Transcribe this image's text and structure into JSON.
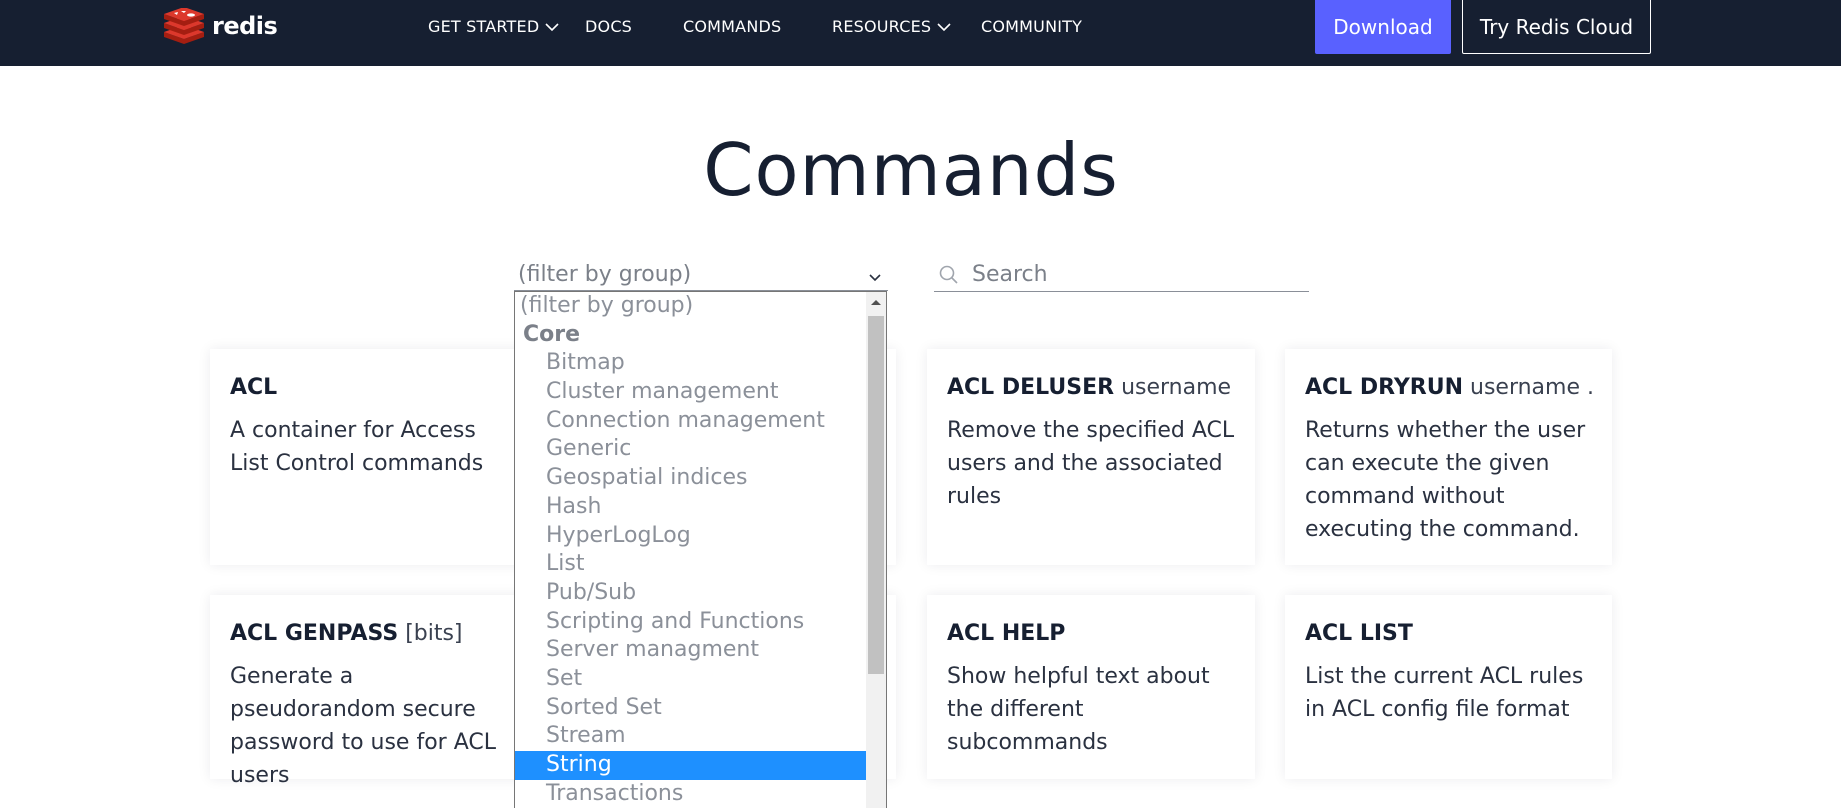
{
  "nav": {
    "logo_text": "redis",
    "items": [
      {
        "label": "GET STARTED",
        "has_dropdown": true
      },
      {
        "label": "DOCS",
        "has_dropdown": false
      },
      {
        "label": "COMMANDS",
        "has_dropdown": false
      },
      {
        "label": "RESOURCES",
        "has_dropdown": true
      },
      {
        "label": "COMMUNITY",
        "has_dropdown": false
      }
    ],
    "download_label": "Download",
    "cloud_label": "Try Redis Cloud"
  },
  "page": {
    "title": "Commands"
  },
  "filter": {
    "selected": "(filter by group)",
    "search_placeholder": "Search",
    "search_value": ""
  },
  "dropdown": {
    "options": [
      {
        "label": "(filter by group)",
        "kind": "placeholder"
      },
      {
        "label": "Core",
        "kind": "group"
      },
      {
        "label": "Bitmap",
        "kind": "item"
      },
      {
        "label": "Cluster management",
        "kind": "item"
      },
      {
        "label": "Connection management",
        "kind": "item"
      },
      {
        "label": "Generic",
        "kind": "item"
      },
      {
        "label": "Geospatial indices",
        "kind": "item"
      },
      {
        "label": "Hash",
        "kind": "item"
      },
      {
        "label": "HyperLogLog",
        "kind": "item"
      },
      {
        "label": "List",
        "kind": "item"
      },
      {
        "label": "Pub/Sub",
        "kind": "item"
      },
      {
        "label": "Scripting and Functions",
        "kind": "item"
      },
      {
        "label": "Server managment",
        "kind": "item"
      },
      {
        "label": "Set",
        "kind": "item"
      },
      {
        "label": "Sorted Set",
        "kind": "item"
      },
      {
        "label": "Stream",
        "kind": "item"
      },
      {
        "label": "String",
        "kind": "item",
        "highlighted": true
      },
      {
        "label": "Transactions",
        "kind": "item"
      }
    ]
  },
  "cards": [
    {
      "command": "ACL",
      "args": "",
      "description": "A container for Access List Control commands"
    },
    {
      "command": "ACL DELUSER",
      "args": "username ...",
      "description": "Remove the specified ACL users and the associated rules"
    },
    {
      "command": "ACL DRYRUN",
      "args": "username ...",
      "description": "Returns whether the user can execute the given command without executing the command."
    },
    {
      "command": "ACL GENPASS",
      "args": "[bits]",
      "description": "Generate a pseudorandom secure password to use for ACL users"
    },
    {
      "command": "ACL HELP",
      "args": "",
      "description": "Show helpful text about the different subcommands"
    },
    {
      "command": "ACL LIST",
      "args": "",
      "description": "List the current ACL rules in ACL config file format"
    }
  ],
  "colors": {
    "nav_bg": "#161f31",
    "download_bg": "#5961ff",
    "highlight": "#1e90ff",
    "logo_red": "#dc382c"
  }
}
